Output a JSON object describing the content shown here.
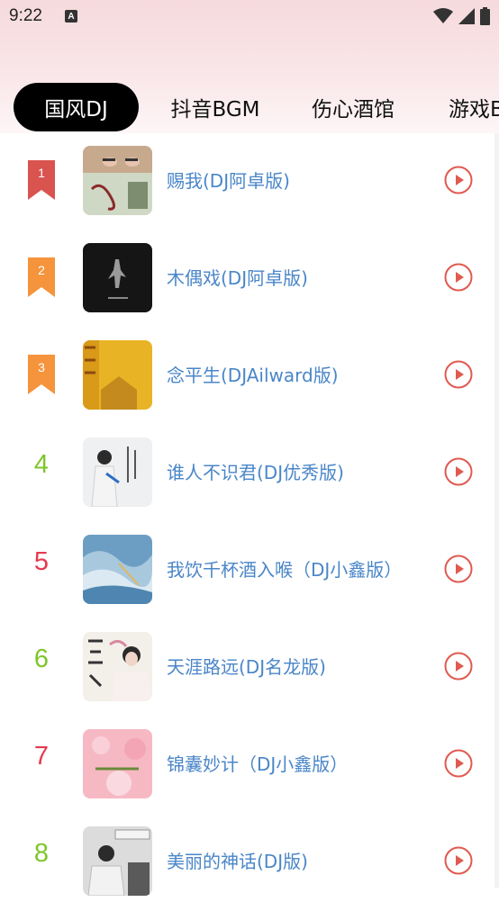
{
  "status_bar": {
    "time": "9:22",
    "notification_icon": "A"
  },
  "tabs": [
    {
      "label": "国风DJ",
      "active": true
    },
    {
      "label": "抖音BGM",
      "active": false
    },
    {
      "label": "伤心酒馆",
      "active": false
    },
    {
      "label": "游戏BGM",
      "active": false
    }
  ],
  "songs": [
    {
      "rank": "1",
      "title": "赐我(DJ阿卓版)",
      "rank_style": "flag",
      "rank_color": "#d9534f"
    },
    {
      "rank": "2",
      "title": "木偶戏(DJ阿卓版)",
      "rank_style": "flag",
      "rank_color": "#f5943c"
    },
    {
      "rank": "3",
      "title": "念平生(DJAilward版)",
      "rank_style": "flag",
      "rank_color": "#f5943c"
    },
    {
      "rank": "4",
      "title": "谁人不识君(DJ优秀版)",
      "rank_style": "number",
      "rank_color": "#7ec62b"
    },
    {
      "rank": "5",
      "title": "我饮千杯酒入喉（DJ小鑫版）",
      "rank_style": "number",
      "rank_color": "#e6394f"
    },
    {
      "rank": "6",
      "title": "天涯路远(DJ名龙版)",
      "rank_style": "number",
      "rank_color": "#7ec62b"
    },
    {
      "rank": "7",
      "title": "锦囊妙计（DJ小鑫版）",
      "rank_style": "number",
      "rank_color": "#e6394f"
    },
    {
      "rank": "8",
      "title": "美丽的神话(DJ版)",
      "rank_style": "number",
      "rank_color": "#7ec62b"
    }
  ],
  "icons": {
    "play": "play-circle-icon",
    "wifi": "wifi-icon",
    "signal": "signal-icon",
    "battery": "battery-icon"
  },
  "colors": {
    "title_text": "#4a86c8",
    "play_accent": "#e05a50",
    "active_tab_bg": "#000000"
  }
}
